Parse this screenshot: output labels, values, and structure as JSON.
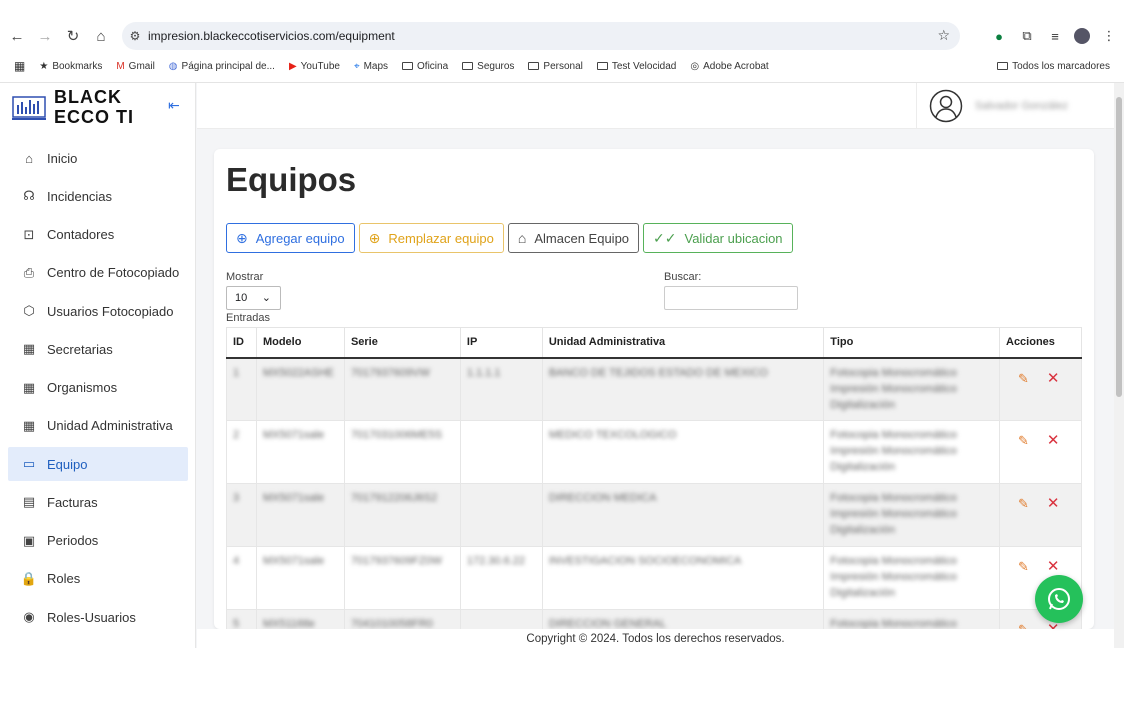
{
  "browser": {
    "url": "impresion.blackeccotiservicios.com/equipment",
    "bookmarks": [
      {
        "label": "Bookmarks",
        "icon": "star-icon"
      },
      {
        "label": "Gmail",
        "icon": "gmail-icon"
      },
      {
        "label": "Página principal de...",
        "icon": "chrome-icon"
      },
      {
        "label": "YouTube",
        "icon": "youtube-icon"
      },
      {
        "label": "Maps",
        "icon": "maps-icon"
      },
      {
        "label": "Oficina",
        "icon": "folder-icon"
      },
      {
        "label": "Seguros",
        "icon": "folder-icon"
      },
      {
        "label": "Personal",
        "icon": "folder-icon"
      },
      {
        "label": "Test Velocidad",
        "icon": "folder-icon"
      },
      {
        "label": "Adobe Acrobat",
        "icon": "globe-icon"
      }
    ],
    "all_bookmarks": "Todos los marcadores"
  },
  "brand": {
    "name": "BLACK ECCO TI"
  },
  "user": {
    "name": "Salvador González"
  },
  "sidebar": {
    "items": [
      {
        "label": "Inicio",
        "icon": "home-icon"
      },
      {
        "label": "Incidencias",
        "icon": "headset-icon"
      },
      {
        "label": "Contadores",
        "icon": "counter-icon"
      },
      {
        "label": "Centro de Fotocopiado",
        "icon": "printer-icon"
      },
      {
        "label": "Usuarios Fotocopiado",
        "icon": "box-icon"
      },
      {
        "label": "Secretarias",
        "icon": "building-icon"
      },
      {
        "label": "Organismos",
        "icon": "building-icon"
      },
      {
        "label": "Unidad Administrativa",
        "icon": "building-icon"
      },
      {
        "label": "Equipo",
        "icon": "monitor-icon"
      },
      {
        "label": "Facturas",
        "icon": "invoice-icon"
      },
      {
        "label": "Periodos",
        "icon": "calendar-icon"
      },
      {
        "label": "Roles",
        "icon": "lock-icon"
      },
      {
        "label": "Roles-Usuarios",
        "icon": "eye-icon"
      }
    ]
  },
  "page": {
    "title": "Equipos",
    "buttons": {
      "add": "Agregar equipo",
      "replace": "Remplazar equipo",
      "warehouse": "Almacen Equipo",
      "validate": "Validar ubicacion"
    },
    "show_label": "Mostrar",
    "show_value": "10",
    "entries_label": "Entradas",
    "search_label": "Buscar:"
  },
  "table": {
    "headers": [
      "ID",
      "Modelo",
      "Serie",
      "IP",
      "Unidad Administrativa",
      "Tipo",
      "Acciones"
    ],
    "rows": [
      {
        "id": "1",
        "modelo": "MX5022ASHE",
        "serie": "7017937609VW",
        "ip": "1.1.1.1",
        "unidad": "BANCO DE TEJIDOS ESTADO DE MEXICO",
        "tipo": [
          "Fotocopia Monocromático",
          "Impresión Monocromático",
          "Digitalización"
        ]
      },
      {
        "id": "2",
        "modelo": "MX5071sale",
        "serie": "7017031006ME5S",
        "ip": "",
        "unidad": "MEDICO TEXCOLOGICO",
        "tipo": [
          "Fotocopia Monocromático",
          "Impresión Monocromático",
          "Digitalización"
        ]
      },
      {
        "id": "3",
        "modelo": "MX5071sale",
        "serie": "7017912206J6S2",
        "ip": "",
        "unidad": "DIRECCION MEDICA",
        "tipo": [
          "Fotocopia Monocromático",
          "Impresión Monocromático",
          "Digitalización"
        ]
      },
      {
        "id": "4",
        "modelo": "MX5071sale",
        "serie": "7017937609FZ0W",
        "ip": "172.30.6.22",
        "unidad": "INVESTIGACION SOCIOECONOMICA",
        "tipo": [
          "Fotocopia Monocromático",
          "Impresión Monocromático",
          "Digitalización"
        ]
      },
      {
        "id": "5",
        "modelo": "MX5116tle",
        "serie": "7041010058FR0",
        "ip": "",
        "unidad": "DIRECCION GENERAL",
        "tipo": [
          "Fotocopia Monocromático"
        ]
      }
    ]
  },
  "footer": {
    "copyright": "Copyright © 2024. Todos los derechos reservados."
  }
}
